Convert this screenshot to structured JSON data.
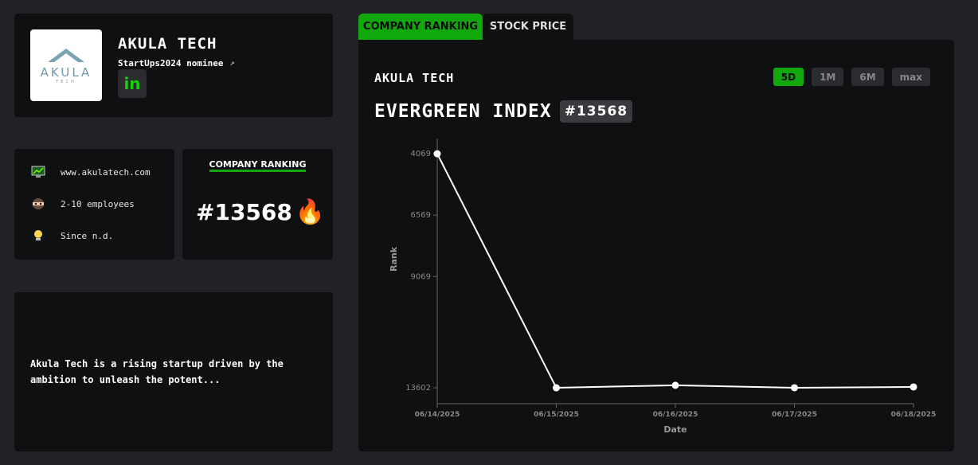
{
  "profile": {
    "logo_word": "AKULA",
    "logo_sub": "TECH",
    "name": "AKULA TECH",
    "nominee": "StartUps2024 nominee",
    "linkedin_label": "in"
  },
  "info": {
    "website": "www.akulatech.com",
    "employees": "2-10 employees",
    "since": "Since n.d."
  },
  "ranking_card": {
    "title": "COMPANY RANKING",
    "value": "#13568"
  },
  "description": "Akula Tech is a rising startup driven by the ambition to unleash the potent...",
  "tabs": [
    {
      "label": "COMPANY RANKING",
      "active": true
    },
    {
      "label": "STOCK PRICE",
      "active": false
    }
  ],
  "chart_panel": {
    "company": "AKULA TECH",
    "heading": "EVERGREEN INDEX",
    "badge": "#13568",
    "ranges": [
      {
        "label": "5D",
        "active": true
      },
      {
        "label": "1M",
        "active": false
      },
      {
        "label": "6M",
        "active": false
      },
      {
        "label": "max",
        "active": false
      }
    ]
  },
  "colors": {
    "accent": "#11a80c",
    "background": "#202226",
    "panel": "#0f1012"
  },
  "chart_data": {
    "type": "line",
    "x": [
      "06/14/2025",
      "06/15/2025",
      "06/16/2025",
      "06/17/2025",
      "06/18/2025"
    ],
    "series": [
      {
        "values": [
          4069,
          13602,
          13500,
          13600,
          13568
        ]
      }
    ],
    "xlabel": "Date",
    "ylabel": "Rank",
    "yticks": [
      4069,
      6569,
      9069,
      13602
    ],
    "ylim": [
      3450,
      14250
    ],
    "y_inverted": true,
    "grid": false
  }
}
